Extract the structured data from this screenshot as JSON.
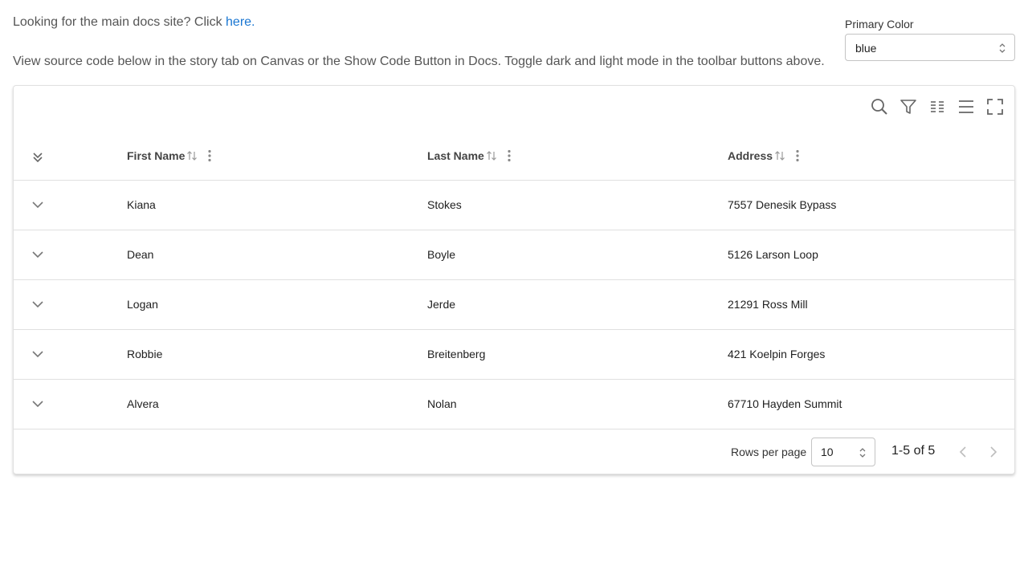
{
  "intro": {
    "docs_prefix": "Looking for the main docs site? Click ",
    "docs_link": "here.",
    "instructions": "View source code below in the story tab on Canvas or the Show Code Button in Docs. Toggle dark and light mode in the toolbar buttons above."
  },
  "primary_color": {
    "label": "Primary Color",
    "value": "blue"
  },
  "toolbar": {
    "icons": [
      "search-icon",
      "filter-icon",
      "columns-icon",
      "density-icon",
      "fullscreen-icon"
    ]
  },
  "table": {
    "columns": [
      {
        "key": "first_name",
        "label": "First Name"
      },
      {
        "key": "last_name",
        "label": "Last Name"
      },
      {
        "key": "address",
        "label": "Address"
      }
    ],
    "rows": [
      {
        "first_name": "Kiana",
        "last_name": "Stokes",
        "address": "7557 Denesik Bypass"
      },
      {
        "first_name": "Dean",
        "last_name": "Boyle",
        "address": "5126 Larson Loop"
      },
      {
        "first_name": "Logan",
        "last_name": "Jerde",
        "address": "21291 Ross Mill"
      },
      {
        "first_name": "Robbie",
        "last_name": "Breitenberg",
        "address": "421 Koelpin Forges"
      },
      {
        "first_name": "Alvera",
        "last_name": "Nolan",
        "address": "67710 Hayden Summit"
      }
    ]
  },
  "pagination": {
    "rows_per_page_label": "Rows per page",
    "rows_per_page": "10",
    "range": "1-5 of 5"
  },
  "colors": {
    "link": "#1976d2",
    "border": "#e0e0e0",
    "icon": "#757575"
  }
}
